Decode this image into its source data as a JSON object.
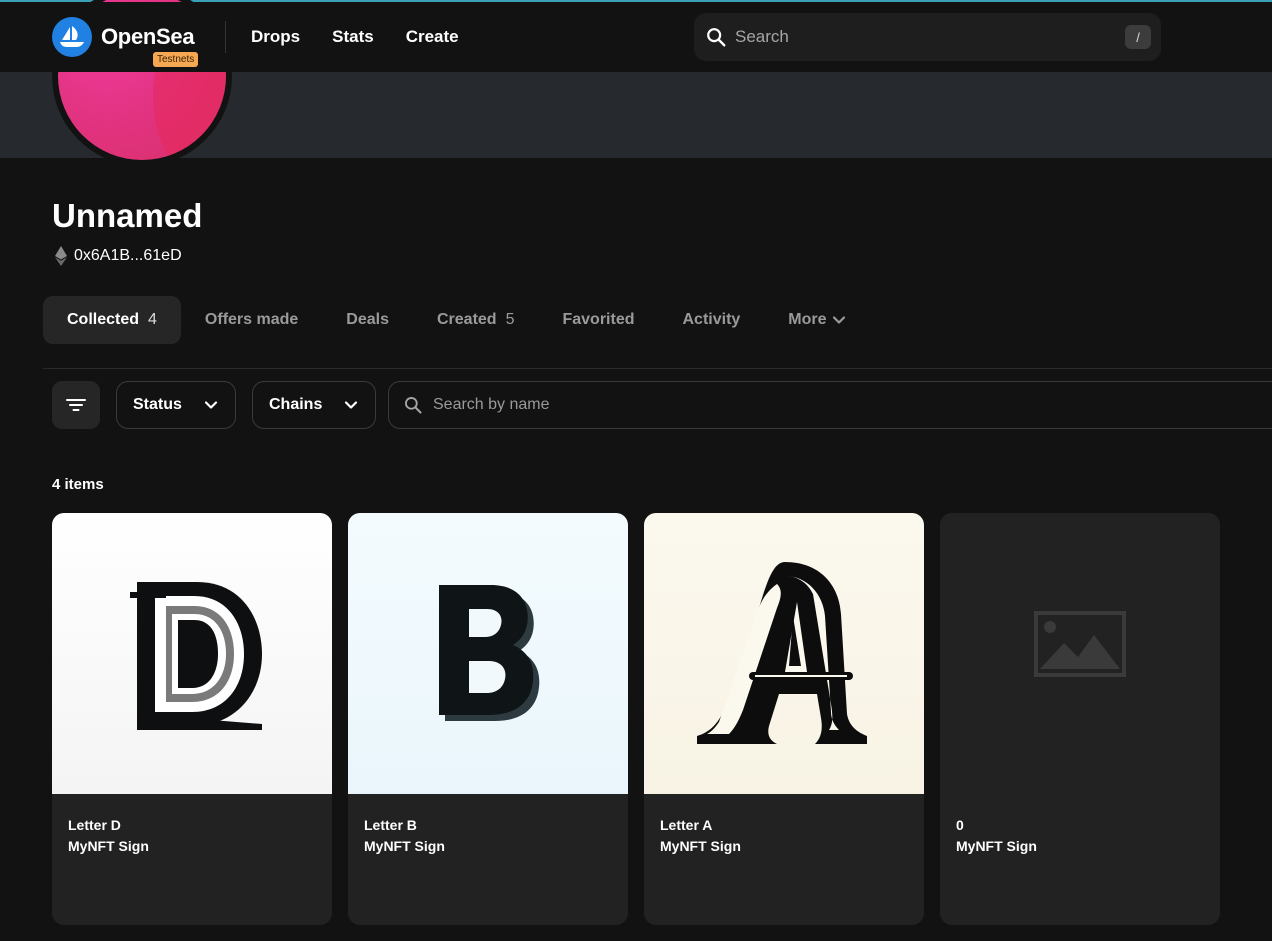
{
  "header": {
    "brand": "OpenSea",
    "badge": "Testnets",
    "nav": [
      "Drops",
      "Stats",
      "Create"
    ],
    "search_placeholder": "Search",
    "search_shortcut": "/"
  },
  "profile": {
    "name": "Unnamed",
    "address": "0x6A1B...61eD"
  },
  "tabs": [
    {
      "label": "Collected",
      "count": "4",
      "active": true
    },
    {
      "label": "Offers made",
      "count": ""
    },
    {
      "label": "Deals",
      "count": ""
    },
    {
      "label": "Created",
      "count": "5"
    },
    {
      "label": "Favorited",
      "count": ""
    },
    {
      "label": "Activity",
      "count": ""
    },
    {
      "label": "More",
      "count": ""
    }
  ],
  "filters": {
    "status_label": "Status",
    "chains_label": "Chains",
    "name_search_placeholder": "Search by name"
  },
  "items_count": "4 items",
  "items": [
    {
      "title": "Letter D",
      "collection": "MyNFT Sign",
      "image": "letter-d-art"
    },
    {
      "title": "Letter B",
      "collection": "MyNFT Sign",
      "image": "letter-b-art"
    },
    {
      "title": "Letter A",
      "collection": "MyNFT Sign",
      "image": "letter-a-art"
    },
    {
      "title": "0",
      "collection": "MyNFT Sign",
      "image": "image-placeholder-icon"
    }
  ],
  "colors": {
    "background": "#121212",
    "accent": "#2081e2",
    "badge": "#f6a752",
    "card": "#222222",
    "banner": "#262a2e",
    "avatar": "#e0327d"
  }
}
